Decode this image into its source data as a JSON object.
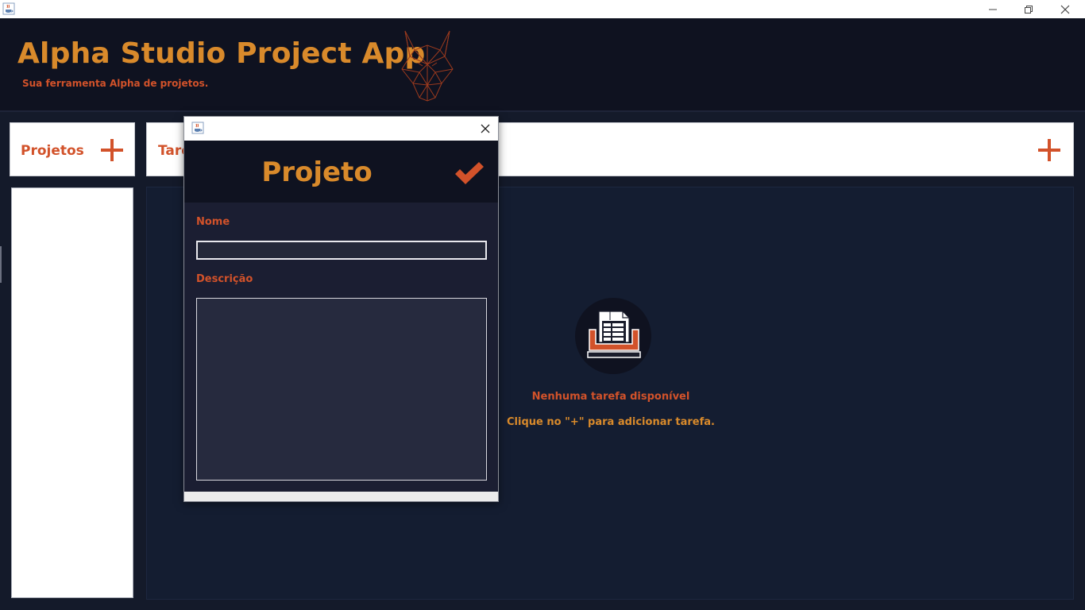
{
  "window": {
    "icon": "java-cup-icon",
    "controls": [
      "minimize-icon",
      "restore-icon",
      "close-icon"
    ]
  },
  "header": {
    "title": "Alpha Studio Project App",
    "subtitle": "Sua ferramenta Alpha de projetos.",
    "logo": "wolf-logo"
  },
  "projects": {
    "label": "Projetos",
    "add_icon": "plus-icon"
  },
  "tasks": {
    "label": "Tare",
    "add_icon": "plus-icon",
    "empty_title": "Nenhuma tarefa disponível",
    "empty_hint": "Clique no \"+\" para adicionar tarefa."
  },
  "dialog": {
    "title": "Projeto",
    "confirm_icon": "check-icon",
    "name_label": "Nome",
    "name_value": "",
    "description_label": "Descrição",
    "description_value": ""
  },
  "colors": {
    "accent_orange": "#d98a2b",
    "accent_red": "#d2522a",
    "dark_bg": "#0f1220",
    "panel_bg": "#141d31"
  }
}
